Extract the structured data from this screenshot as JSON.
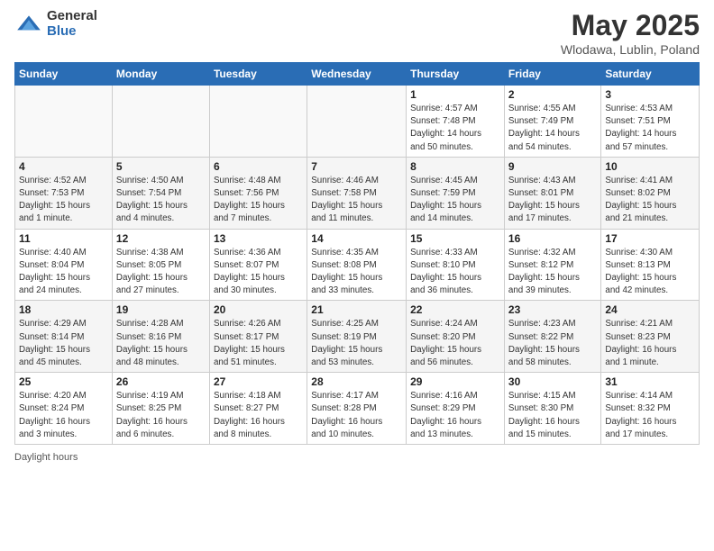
{
  "header": {
    "logo_general": "General",
    "logo_blue": "Blue",
    "title": "May 2025",
    "location": "Wlodawa, Lublin, Poland"
  },
  "days_of_week": [
    "Sunday",
    "Monday",
    "Tuesday",
    "Wednesday",
    "Thursday",
    "Friday",
    "Saturday"
  ],
  "weeks": [
    [
      {
        "num": "",
        "info": ""
      },
      {
        "num": "",
        "info": ""
      },
      {
        "num": "",
        "info": ""
      },
      {
        "num": "",
        "info": ""
      },
      {
        "num": "1",
        "info": "Sunrise: 4:57 AM\nSunset: 7:48 PM\nDaylight: 14 hours\nand 50 minutes."
      },
      {
        "num": "2",
        "info": "Sunrise: 4:55 AM\nSunset: 7:49 PM\nDaylight: 14 hours\nand 54 minutes."
      },
      {
        "num": "3",
        "info": "Sunrise: 4:53 AM\nSunset: 7:51 PM\nDaylight: 14 hours\nand 57 minutes."
      }
    ],
    [
      {
        "num": "4",
        "info": "Sunrise: 4:52 AM\nSunset: 7:53 PM\nDaylight: 15 hours\nand 1 minute."
      },
      {
        "num": "5",
        "info": "Sunrise: 4:50 AM\nSunset: 7:54 PM\nDaylight: 15 hours\nand 4 minutes."
      },
      {
        "num": "6",
        "info": "Sunrise: 4:48 AM\nSunset: 7:56 PM\nDaylight: 15 hours\nand 7 minutes."
      },
      {
        "num": "7",
        "info": "Sunrise: 4:46 AM\nSunset: 7:58 PM\nDaylight: 15 hours\nand 11 minutes."
      },
      {
        "num": "8",
        "info": "Sunrise: 4:45 AM\nSunset: 7:59 PM\nDaylight: 15 hours\nand 14 minutes."
      },
      {
        "num": "9",
        "info": "Sunrise: 4:43 AM\nSunset: 8:01 PM\nDaylight: 15 hours\nand 17 minutes."
      },
      {
        "num": "10",
        "info": "Sunrise: 4:41 AM\nSunset: 8:02 PM\nDaylight: 15 hours\nand 21 minutes."
      }
    ],
    [
      {
        "num": "11",
        "info": "Sunrise: 4:40 AM\nSunset: 8:04 PM\nDaylight: 15 hours\nand 24 minutes."
      },
      {
        "num": "12",
        "info": "Sunrise: 4:38 AM\nSunset: 8:05 PM\nDaylight: 15 hours\nand 27 minutes."
      },
      {
        "num": "13",
        "info": "Sunrise: 4:36 AM\nSunset: 8:07 PM\nDaylight: 15 hours\nand 30 minutes."
      },
      {
        "num": "14",
        "info": "Sunrise: 4:35 AM\nSunset: 8:08 PM\nDaylight: 15 hours\nand 33 minutes."
      },
      {
        "num": "15",
        "info": "Sunrise: 4:33 AM\nSunset: 8:10 PM\nDaylight: 15 hours\nand 36 minutes."
      },
      {
        "num": "16",
        "info": "Sunrise: 4:32 AM\nSunset: 8:12 PM\nDaylight: 15 hours\nand 39 minutes."
      },
      {
        "num": "17",
        "info": "Sunrise: 4:30 AM\nSunset: 8:13 PM\nDaylight: 15 hours\nand 42 minutes."
      }
    ],
    [
      {
        "num": "18",
        "info": "Sunrise: 4:29 AM\nSunset: 8:14 PM\nDaylight: 15 hours\nand 45 minutes."
      },
      {
        "num": "19",
        "info": "Sunrise: 4:28 AM\nSunset: 8:16 PM\nDaylight: 15 hours\nand 48 minutes."
      },
      {
        "num": "20",
        "info": "Sunrise: 4:26 AM\nSunset: 8:17 PM\nDaylight: 15 hours\nand 51 minutes."
      },
      {
        "num": "21",
        "info": "Sunrise: 4:25 AM\nSunset: 8:19 PM\nDaylight: 15 hours\nand 53 minutes."
      },
      {
        "num": "22",
        "info": "Sunrise: 4:24 AM\nSunset: 8:20 PM\nDaylight: 15 hours\nand 56 minutes."
      },
      {
        "num": "23",
        "info": "Sunrise: 4:23 AM\nSunset: 8:22 PM\nDaylight: 15 hours\nand 58 minutes."
      },
      {
        "num": "24",
        "info": "Sunrise: 4:21 AM\nSunset: 8:23 PM\nDaylight: 16 hours\nand 1 minute."
      }
    ],
    [
      {
        "num": "25",
        "info": "Sunrise: 4:20 AM\nSunset: 8:24 PM\nDaylight: 16 hours\nand 3 minutes."
      },
      {
        "num": "26",
        "info": "Sunrise: 4:19 AM\nSunset: 8:25 PM\nDaylight: 16 hours\nand 6 minutes."
      },
      {
        "num": "27",
        "info": "Sunrise: 4:18 AM\nSunset: 8:27 PM\nDaylight: 16 hours\nand 8 minutes."
      },
      {
        "num": "28",
        "info": "Sunrise: 4:17 AM\nSunset: 8:28 PM\nDaylight: 16 hours\nand 10 minutes."
      },
      {
        "num": "29",
        "info": "Sunrise: 4:16 AM\nSunset: 8:29 PM\nDaylight: 16 hours\nand 13 minutes."
      },
      {
        "num": "30",
        "info": "Sunrise: 4:15 AM\nSunset: 8:30 PM\nDaylight: 16 hours\nand 15 minutes."
      },
      {
        "num": "31",
        "info": "Sunrise: 4:14 AM\nSunset: 8:32 PM\nDaylight: 16 hours\nand 17 minutes."
      }
    ]
  ],
  "footer": {
    "label": "Daylight hours"
  }
}
